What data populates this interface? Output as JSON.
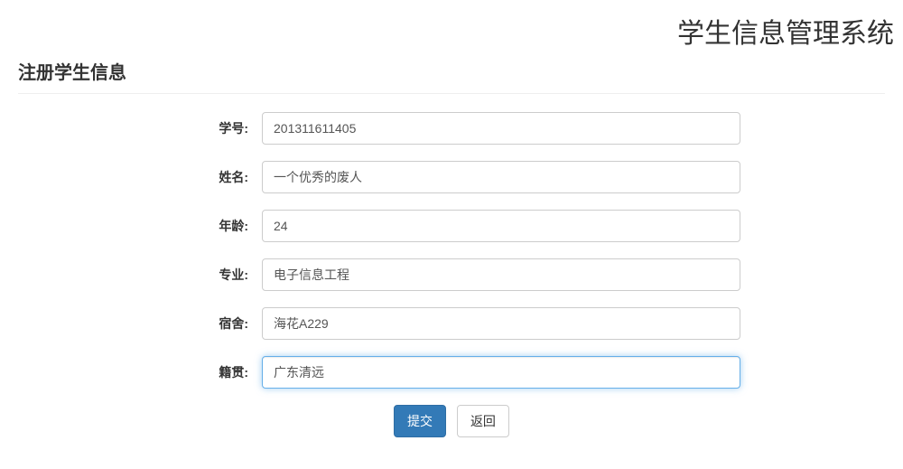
{
  "header": {
    "system_title": "学生信息管理系统",
    "page_title": "注册学生信息"
  },
  "form": {
    "fields": {
      "student_id": {
        "label": "学号:",
        "value": "201311611405"
      },
      "name": {
        "label": "姓名:",
        "value": "一个优秀的废人"
      },
      "age": {
        "label": "年龄:",
        "value": "24"
      },
      "major": {
        "label": "专业:",
        "value": "电子信息工程"
      },
      "dormitory": {
        "label": "宿舍:",
        "value": "海花A229"
      },
      "native_place": {
        "label": "籍贯:",
        "value": "广东清远"
      }
    },
    "buttons": {
      "submit": "提交",
      "back": "返回"
    }
  }
}
